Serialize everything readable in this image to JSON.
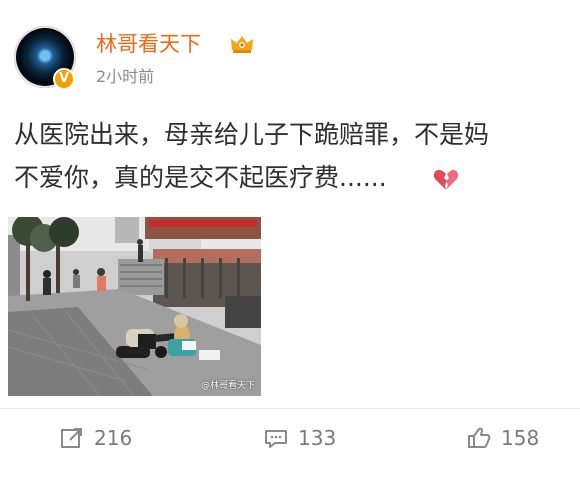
{
  "post": {
    "username": "林哥看天下",
    "timestamp": "2小时前",
    "text": "从医院出来，母亲给儿子下跪赔罪，不是妈\n不爱你，真的是交不起医疗费......",
    "verification_icon": "verified-v-icon",
    "member_icon": "crown-icon",
    "emoji": "broken-heart-icon"
  },
  "image": {
    "watermark": "@林哥看天下"
  },
  "actions": {
    "share_count": "216",
    "comment_count": "133",
    "like_count": "158",
    "share_icon": "share-icon",
    "comment_icon": "comment-icon",
    "like_icon": "like-icon"
  },
  "colors": {
    "username": "#f06a14",
    "verified_badge": "#f6a000",
    "text": "#2f2f2f",
    "muted": "#7a7a7a"
  }
}
